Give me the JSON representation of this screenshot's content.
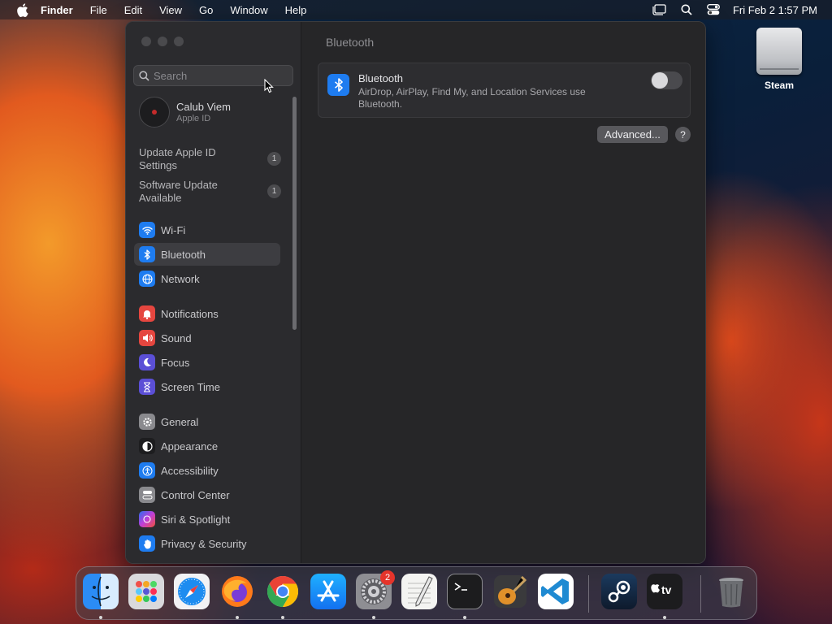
{
  "menubar": {
    "app": "Finder",
    "items": [
      "File",
      "Edit",
      "View",
      "Go",
      "Window",
      "Help"
    ],
    "clock": "Fri Feb 2  1:57 PM"
  },
  "desktop": {
    "icon_label": "Steam"
  },
  "sidebar": {
    "search_placeholder": "Search",
    "account": {
      "name": "Calub Viem",
      "sub": "Apple ID"
    },
    "notices": [
      {
        "label": "Update Apple ID Settings",
        "badge": "1"
      },
      {
        "label": "Software Update Available",
        "badge": "1"
      }
    ],
    "items": [
      {
        "label": "Wi-Fi",
        "color": "#1e7cf0",
        "icon": "wifi-icon"
      },
      {
        "label": "Bluetooth",
        "color": "#1e7cf0",
        "icon": "bluetooth-icon"
      },
      {
        "label": "Network",
        "color": "#1e7cf0",
        "icon": "globe-icon"
      },
      {
        "label": "Notifications",
        "color": "#e5463f",
        "icon": "bell-icon"
      },
      {
        "label": "Sound",
        "color": "#e5463f",
        "icon": "speaker-icon"
      },
      {
        "label": "Focus",
        "color": "#5b4fd6",
        "icon": "moon-icon"
      },
      {
        "label": "Screen Time",
        "color": "#5b4fd6",
        "icon": "hourglass-icon"
      },
      {
        "label": "General",
        "color": "#8a8a8e",
        "icon": "gear-icon"
      },
      {
        "label": "Appearance",
        "color": "#1d1d1f",
        "icon": "appearance-icon"
      },
      {
        "label": "Accessibility",
        "color": "#1e7cf0",
        "icon": "accessibility-icon"
      },
      {
        "label": "Control Center",
        "color": "#8a8a8e",
        "icon": "control-center-icon"
      },
      {
        "label": "Siri & Spotlight",
        "color": "#c03fd8",
        "icon": "siri-icon"
      },
      {
        "label": "Privacy & Security",
        "color": "#1e7cf0",
        "icon": "hand-icon"
      }
    ]
  },
  "main": {
    "title": "Bluetooth",
    "card_title": "Bluetooth",
    "card_desc": "AirDrop, AirPlay, Find My, and Location Services use Bluetooth.",
    "advanced_label": "Advanced...",
    "help_label": "?"
  },
  "dock": {
    "settings_badge": "2"
  }
}
